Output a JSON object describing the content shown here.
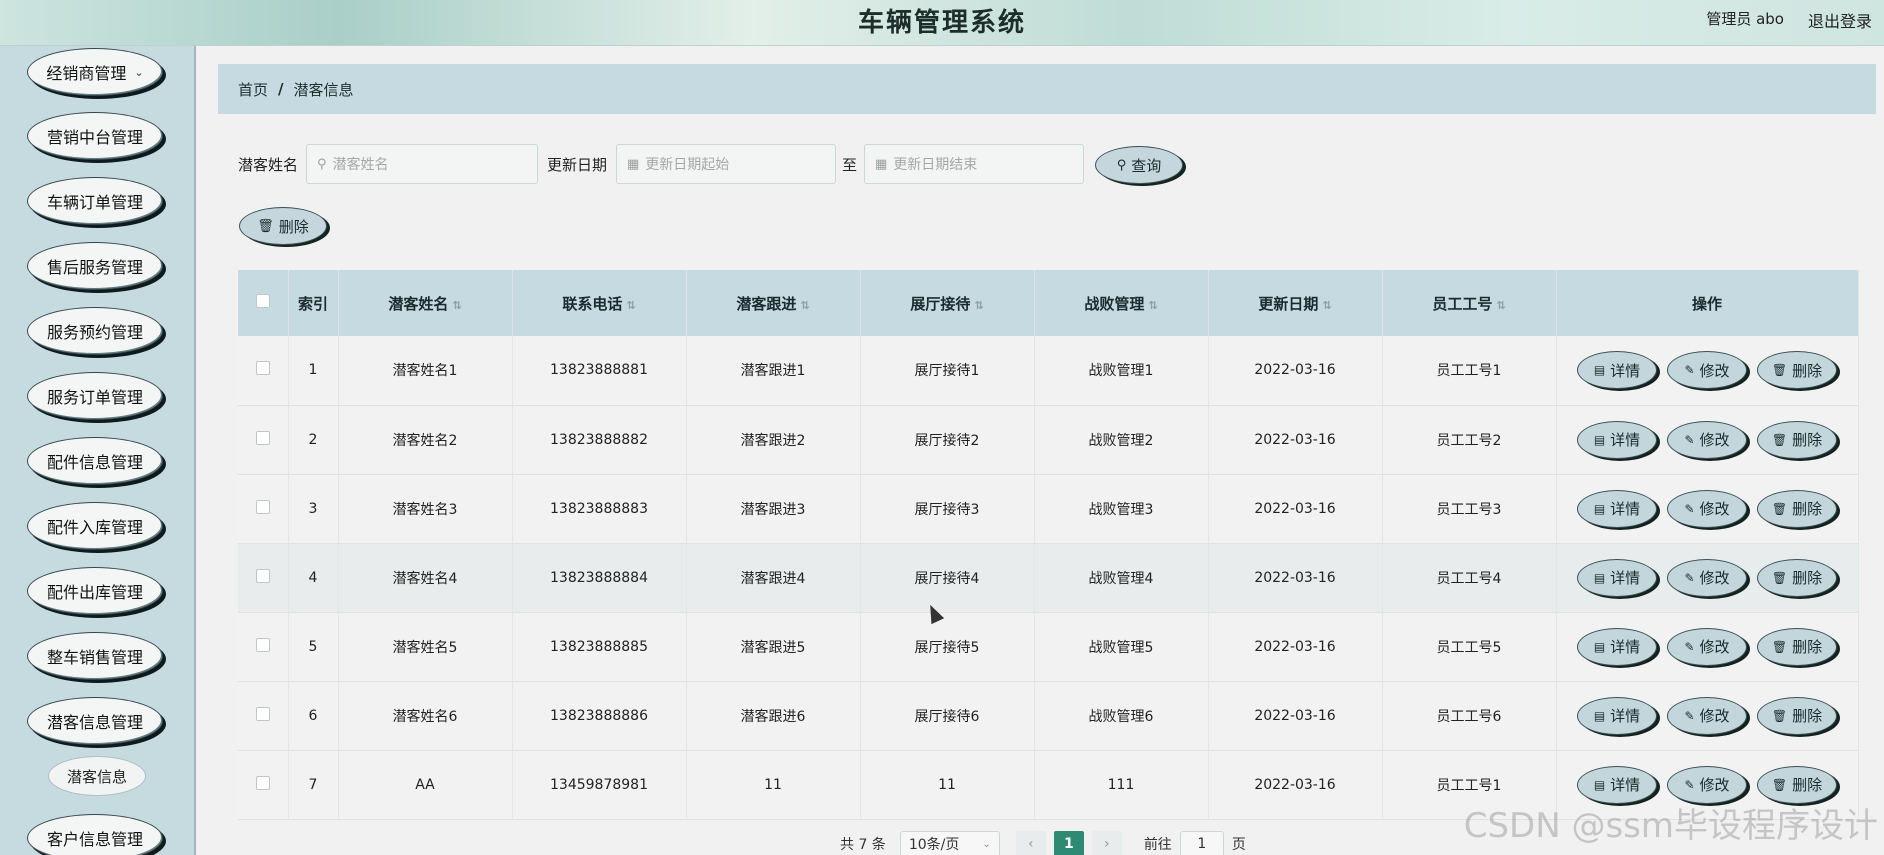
{
  "header": {
    "title": "车辆管理系统",
    "user": "管理员 abo",
    "logout": "退出登录"
  },
  "sidebar": {
    "items": [
      {
        "label": "经销商管理",
        "chevron": true
      },
      {
        "label": "营销中台管理"
      },
      {
        "label": "车辆订单管理"
      },
      {
        "label": "售后服务管理"
      },
      {
        "label": "服务预约管理"
      },
      {
        "label": "服务订单管理"
      },
      {
        "label": "配件信息管理"
      },
      {
        "label": "配件入库管理"
      },
      {
        "label": "配件出库管理"
      },
      {
        "label": "整车销售管理"
      },
      {
        "label": "潜客信息管理"
      },
      {
        "label": "客户信息管理"
      }
    ],
    "sub_item": "潜客信息"
  },
  "breadcrumb": {
    "home": "首页",
    "separator": "/",
    "current": "潜客信息"
  },
  "search": {
    "name_label": "潜客姓名",
    "name_placeholder": "潜客姓名",
    "date_label": "更新日期",
    "date_start_placeholder": "更新日期起始",
    "date_to": "至",
    "date_end_placeholder": "更新日期结束",
    "query_button": "查询",
    "delete_button": "删除"
  },
  "table": {
    "headers": [
      "索引",
      "潜客姓名",
      "联系电话",
      "潜客跟进",
      "展厅接待",
      "战败管理",
      "更新日期",
      "员工工号",
      "操作"
    ],
    "rows": [
      {
        "index": "1",
        "name": "潜客姓名1",
        "phone": "13823888881",
        "follow": "潜客跟进1",
        "reception": "展厅接待1",
        "defeat": "战败管理1",
        "date": "2022-03-16",
        "staff": "员工工号1"
      },
      {
        "index": "2",
        "name": "潜客姓名2",
        "phone": "13823888882",
        "follow": "潜客跟进2",
        "reception": "展厅接待2",
        "defeat": "战败管理2",
        "date": "2022-03-16",
        "staff": "员工工号2"
      },
      {
        "index": "3",
        "name": "潜客姓名3",
        "phone": "13823888883",
        "follow": "潜客跟进3",
        "reception": "展厅接待3",
        "defeat": "战败管理3",
        "date": "2022-03-16",
        "staff": "员工工号3"
      },
      {
        "index": "4",
        "name": "潜客姓名4",
        "phone": "13823888884",
        "follow": "潜客跟进4",
        "reception": "展厅接待4",
        "defeat": "战败管理4",
        "date": "2022-03-16",
        "staff": "员工工号4"
      },
      {
        "index": "5",
        "name": "潜客姓名5",
        "phone": "13823888885",
        "follow": "潜客跟进5",
        "reception": "展厅接待5",
        "defeat": "战败管理5",
        "date": "2022-03-16",
        "staff": "员工工号5"
      },
      {
        "index": "6",
        "name": "潜客姓名6",
        "phone": "13823888886",
        "follow": "潜客跟进6",
        "reception": "展厅接待6",
        "defeat": "战败管理6",
        "date": "2022-03-16",
        "staff": "员工工号6"
      },
      {
        "index": "7",
        "name": "AA",
        "phone": "13459878981",
        "follow": "11",
        "reception": "11",
        "defeat": "111",
        "date": "2022-03-16",
        "staff": "员工工号1"
      }
    ],
    "actions": {
      "detail": "详情",
      "edit": "修改",
      "delete": "删除"
    }
  },
  "pagination": {
    "total": "共 7 条",
    "page_size": "10条/页",
    "current_page": "1",
    "goto_label": "前往",
    "goto_value": "1",
    "page_unit": "页"
  },
  "watermark": "CSDN @ssm毕设程序设计",
  "colors": {
    "accent": "#c5dbe1",
    "current_page": "#2f8a73"
  }
}
